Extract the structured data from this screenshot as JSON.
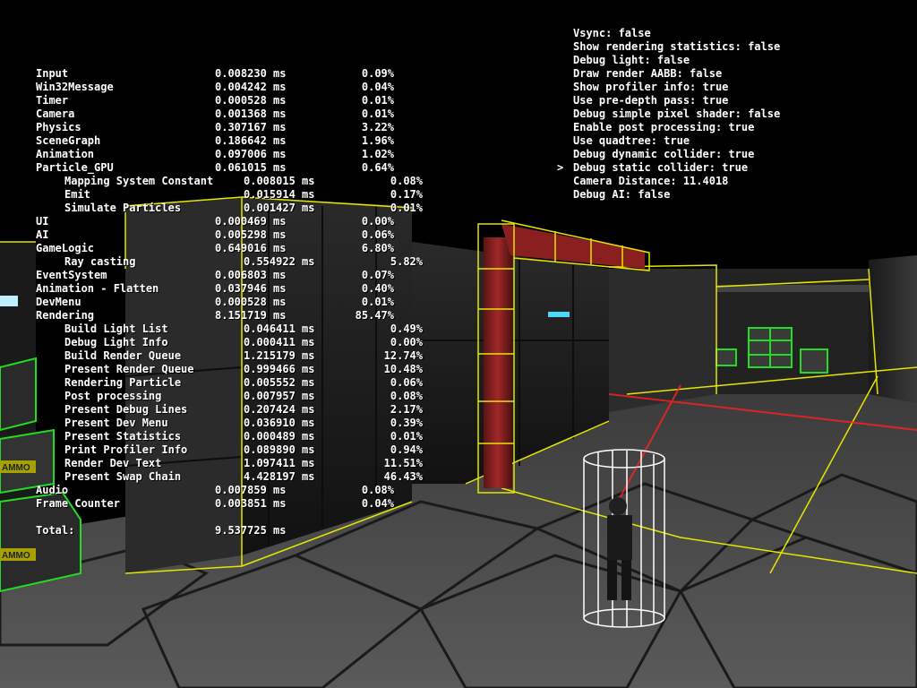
{
  "profiler": {
    "rows": [
      {
        "name": "Input",
        "time": "0.008230 ms",
        "pct": "0.09%",
        "indent": 0
      },
      {
        "name": "Win32Message",
        "time": "0.004242 ms",
        "pct": "0.04%",
        "indent": 0
      },
      {
        "name": "Timer",
        "time": "0.000528 ms",
        "pct": "0.01%",
        "indent": 0
      },
      {
        "name": "Camera",
        "time": "0.001368 ms",
        "pct": "0.01%",
        "indent": 0
      },
      {
        "name": "Physics",
        "time": "0.307167 ms",
        "pct": "3.22%",
        "indent": 0
      },
      {
        "name": "SceneGraph",
        "time": "0.186642 ms",
        "pct": "1.96%",
        "indent": 0
      },
      {
        "name": "Animation",
        "time": "0.097006 ms",
        "pct": "1.02%",
        "indent": 0
      },
      {
        "name": "Particle_GPU",
        "time": "0.061015 ms",
        "pct": "0.64%",
        "indent": 0
      },
      {
        "name": "Mapping System Constant",
        "time": "0.008015 ms",
        "pct": "0.08%",
        "indent": 1
      },
      {
        "name": "Emit",
        "time": "0.015914 ms",
        "pct": "0.17%",
        "indent": 1
      },
      {
        "name": "Simulate Particles",
        "time": "0.001427 ms",
        "pct": "0.01%",
        "indent": 1
      },
      {
        "name": "UI",
        "time": "0.000469 ms",
        "pct": "0.00%",
        "indent": 0
      },
      {
        "name": "AI",
        "time": "0.005298 ms",
        "pct": "0.06%",
        "indent": 0
      },
      {
        "name": "GameLogic",
        "time": "0.649016 ms",
        "pct": "6.80%",
        "indent": 0
      },
      {
        "name": "Ray casting",
        "time": "0.554922 ms",
        "pct": "5.82%",
        "indent": 1
      },
      {
        "name": "EventSystem",
        "time": "0.006803 ms",
        "pct": "0.07%",
        "indent": 0
      },
      {
        "name": "Animation - Flatten",
        "time": "0.037946 ms",
        "pct": "0.40%",
        "indent": 0
      },
      {
        "name": "DevMenu",
        "time": "0.000528 ms",
        "pct": "0.01%",
        "indent": 0
      },
      {
        "name": "Rendering",
        "time": "8.151719 ms",
        "pct": "85.47%",
        "indent": 0
      },
      {
        "name": "Build Light List",
        "time": "0.046411 ms",
        "pct": "0.49%",
        "indent": 1
      },
      {
        "name": "Debug Light Info",
        "time": "0.000411 ms",
        "pct": "0.00%",
        "indent": 1
      },
      {
        "name": "Build Render Queue",
        "time": "1.215179 ms",
        "pct": "12.74%",
        "indent": 1
      },
      {
        "name": "Present Render Queue",
        "time": "0.999466 ms",
        "pct": "10.48%",
        "indent": 1
      },
      {
        "name": "Rendering Particle",
        "time": "0.005552 ms",
        "pct": "0.06%",
        "indent": 1
      },
      {
        "name": "Post processing",
        "time": "0.007957 ms",
        "pct": "0.08%",
        "indent": 1
      },
      {
        "name": "Present Debug Lines",
        "time": "0.207424 ms",
        "pct": "2.17%",
        "indent": 1
      },
      {
        "name": "Present Dev Menu",
        "time": "0.036910 ms",
        "pct": "0.39%",
        "indent": 1
      },
      {
        "name": "Present Statistics",
        "time": "0.000489 ms",
        "pct": "0.01%",
        "indent": 1
      },
      {
        "name": "Print Profiler Info",
        "time": "0.089890 ms",
        "pct": "0.94%",
        "indent": 1
      },
      {
        "name": "Render Dev Text",
        "time": "1.097411 ms",
        "pct": "11.51%",
        "indent": 1
      },
      {
        "name": "Present Swap Chain",
        "time": "4.428197 ms",
        "pct": "46.43%",
        "indent": 1
      },
      {
        "name": "Audio",
        "time": "0.007859 ms",
        "pct": "0.08%",
        "indent": 0
      },
      {
        "name": "Frame Counter",
        "time": "0.003851 ms",
        "pct": "0.04%",
        "indent": 0
      }
    ],
    "total_label": "Total:",
    "total_time": "9.537725 ms"
  },
  "debug_menu": {
    "items": [
      "Vsync: false",
      "Show rendering statistics: false",
      "Debug light: false",
      "Draw render AABB: false",
      "Show profiler info: true",
      "Use pre-depth pass: true",
      "Debug simple pixel shader: false",
      "Enable post processing: true",
      "Use quadtree: true",
      "Debug dynamic collider: true",
      "Debug static collider: true",
      "Camera Distance: 11.4018",
      "Debug AI: false"
    ],
    "selected_index": 10,
    "cursor": ">"
  },
  "scene": {
    "crate_label_1": "AMMO",
    "crate_label_2": "AMMO",
    "colors": {
      "static_collider": "#e6e600",
      "dynamic_collider": "#22dd22",
      "player_capsule": "#ffffff",
      "pipe": "#8a1f1f",
      "laser": "#ff2020",
      "light_strip": "#4fd6ff"
    }
  }
}
